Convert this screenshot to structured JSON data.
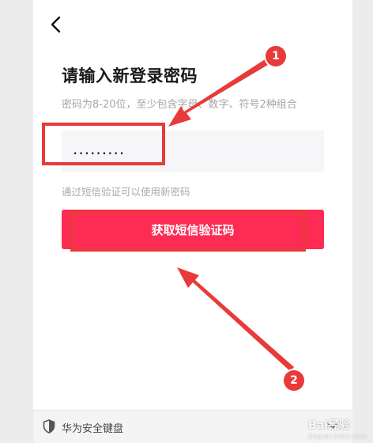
{
  "page": {
    "title": "请输入新登录密码",
    "password_hint": "密码为8-20位，至少包含字母、数字、符号2种组合",
    "password_value": ".........",
    "sms_hint": "通过短信验证可以使用新密码",
    "sms_button_label": "获取短信验证码"
  },
  "keyboard": {
    "label": "华为安全键盘"
  },
  "annotations": {
    "badge_1": "1",
    "badge_2": "2"
  },
  "watermark": {
    "text": "Bai经验",
    "sub": "jingyan.baidu.com"
  },
  "colors": {
    "accent": "#fe2c55",
    "annotation": "#e83a3a"
  }
}
